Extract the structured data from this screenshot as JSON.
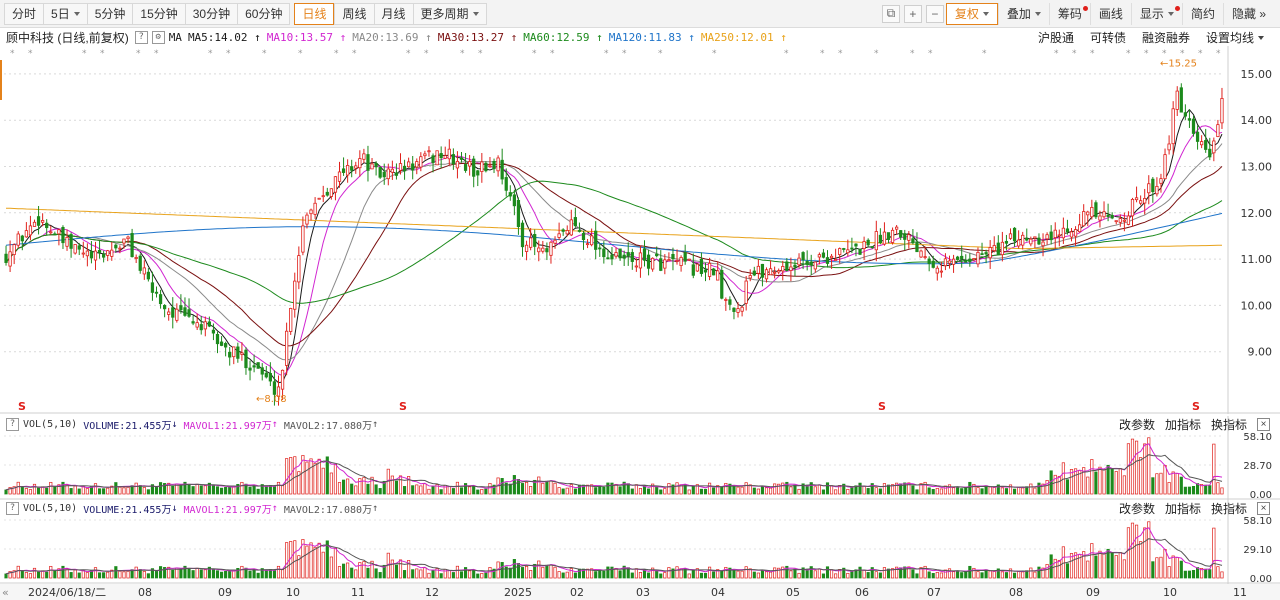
{
  "toolbar": {
    "periods": [
      "分时",
      "5日",
      "5分钟",
      "15分钟",
      "30分钟",
      "60分钟"
    ],
    "active_period": "日线",
    "more_periods": [
      "周线",
      "月线"
    ],
    "more_label": "更多周期",
    "icons": [
      "⧉",
      "+",
      "−"
    ],
    "right_items": {
      "fuquan": "复权",
      "diejia": "叠加",
      "chouma": "筹码",
      "huaxian": "画线",
      "xianshi": "显示",
      "jianyue": "简约",
      "yincang": "隐藏",
      "arrows": "»"
    }
  },
  "stock": {
    "name": "顾中科技",
    "mode": "(日线,前复权)",
    "ma_label": "MA",
    "ma": [
      {
        "label": "MA5:14.02",
        "arrow": "↑",
        "color": "#1a1a1a"
      },
      {
        "label": "MA10:13.57",
        "arrow": "↑",
        "color": "#d126d1"
      },
      {
        "label": "MA20:13.69",
        "arrow": "↑",
        "color": "#8a8a8a"
      },
      {
        "label": "MA30:13.27",
        "arrow": "↑",
        "color": "#7a1010"
      },
      {
        "label": "MA60:12.59",
        "arrow": "↑",
        "color": "#1c8a1c"
      },
      {
        "label": "MA120:11.83",
        "arrow": "↑",
        "color": "#1f74c9"
      },
      {
        "label": "MA250:12.01",
        "arrow": "↑",
        "color": "#e8a21a"
      }
    ],
    "links": [
      "沪股通",
      "可转债",
      "融资融券"
    ],
    "settings": "设置均线"
  },
  "chart_data": {
    "type": "candlestick",
    "ylim": [
      8.0,
      15.3
    ],
    "yticks": [
      "15.00",
      "14.00",
      "13.00",
      "12.00",
      "11.00",
      "10.00",
      "9.00"
    ],
    "high_label": "15.25",
    "low_label": "8.08",
    "s_marker": "S",
    "xticks": [
      "2024/06/18/二",
      "08",
      "09",
      "10",
      "11",
      "12",
      "2025",
      "02",
      "03",
      "04",
      "05",
      "06",
      "07",
      "08",
      "09",
      "10",
      "11"
    ],
    "vol1": {
      "params": "VOL(5,10)",
      "volume": "VOLUME:21.455万",
      "volume_arrow": "↓",
      "mavol1": "MAVOL1:21.997万",
      "mavol1_arrow": "↑",
      "mavol2": "MAVOL2:17.080万",
      "mavol2_arrow": "↑",
      "yticks": [
        "58.10",
        "28.70",
        "0.00"
      ]
    },
    "vol2": {
      "params": "VOL(5,10)",
      "volume": "VOLUME:21.455万",
      "volume_arrow": "↓",
      "mavol1": "MAVOL1:21.997万",
      "mavol1_arrow": "↑",
      "mavol2": "MAVOL2:17.080万",
      "mavol2_arrow": "↑",
      "yticks": [
        "58.10",
        "29.10",
        "0.00"
      ]
    }
  },
  "panel_actions": {
    "change_params": "改参数",
    "add_indicator": "加指标",
    "switch_indicator": "换指标",
    "close": "×"
  },
  "colors": {
    "up": "#e0201b",
    "down": "#1c8a1c",
    "accent": "#e4821b"
  }
}
